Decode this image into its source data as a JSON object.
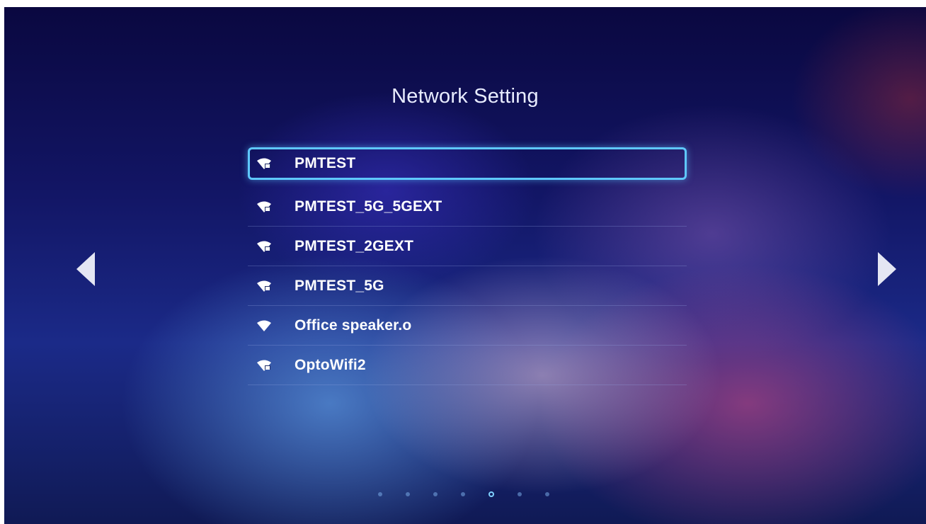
{
  "header": {
    "title": "Network Setting"
  },
  "networks": [
    {
      "ssid": "PMTEST",
      "icon": "wifi-locked-icon",
      "selected": true
    },
    {
      "ssid": "PMTEST_5G_5GEXT",
      "icon": "wifi-locked-icon",
      "selected": false
    },
    {
      "ssid": "PMTEST_2GEXT",
      "icon": "wifi-locked-icon",
      "selected": false
    },
    {
      "ssid": "PMTEST_5G",
      "icon": "wifi-locked-icon",
      "selected": false
    },
    {
      "ssid": "Office speaker.o",
      "icon": "wifi-open-icon",
      "selected": false
    },
    {
      "ssid": "OptoWifi2",
      "icon": "wifi-locked-icon",
      "selected": false
    }
  ],
  "navigation": {
    "prev_icon": "triangle-left-icon",
    "next_icon": "triangle-right-icon"
  },
  "pager": {
    "total_pages": 7,
    "current_page": 5
  },
  "colors": {
    "selection_border": "#5fc8ff",
    "text": "#ffffff",
    "title": "#e8ecff"
  }
}
